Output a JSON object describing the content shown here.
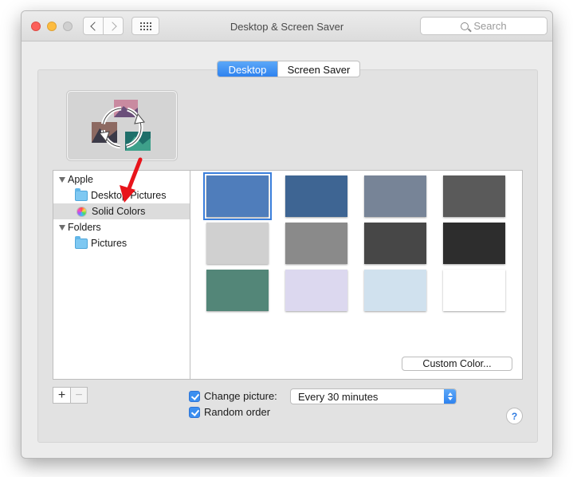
{
  "window": {
    "title": "Desktop & Screen Saver",
    "search_placeholder": "Search"
  },
  "tabs": [
    {
      "label": "Desktop",
      "selected": true
    },
    {
      "label": "Screen Saver",
      "selected": false
    }
  ],
  "sidebar": {
    "groups": [
      {
        "label": "Apple",
        "items": [
          {
            "label": "Desktop Pictures",
            "icon": "folder-icon",
            "selected": false
          },
          {
            "label": "Solid Colors",
            "icon": "color-wheel-icon",
            "selected": true
          }
        ]
      },
      {
        "label": "Folders",
        "items": [
          {
            "label": "Pictures",
            "icon": "pictures-folder-icon",
            "selected": false
          }
        ]
      }
    ]
  },
  "swatches": [
    {
      "color": "#4f7dbb",
      "selected": true
    },
    {
      "color": "#3e6593"
    },
    {
      "color": "#778497"
    },
    {
      "color": "#5a5a5a"
    },
    {
      "color": "#d0d0d0"
    },
    {
      "color": "#8a8a8a"
    },
    {
      "color": "#474747"
    },
    {
      "color": "#2d2d2d"
    },
    {
      "color": "#538678"
    },
    {
      "color": "#dcd8ef"
    },
    {
      "color": "#d0e1ee"
    },
    {
      "color": "#ffffff"
    }
  ],
  "custom_color_label": "Custom Color...",
  "bottom": {
    "add_label": "+",
    "remove_label": "−",
    "change_picture_label": "Change picture:",
    "change_picture_checked": true,
    "interval_value": "Every 30 minutes",
    "random_order_label": "Random order",
    "random_order_checked": true,
    "help_label": "?"
  },
  "colors": {
    "accent": "#2e82ef",
    "annotation_arrow": "#e8141b"
  }
}
